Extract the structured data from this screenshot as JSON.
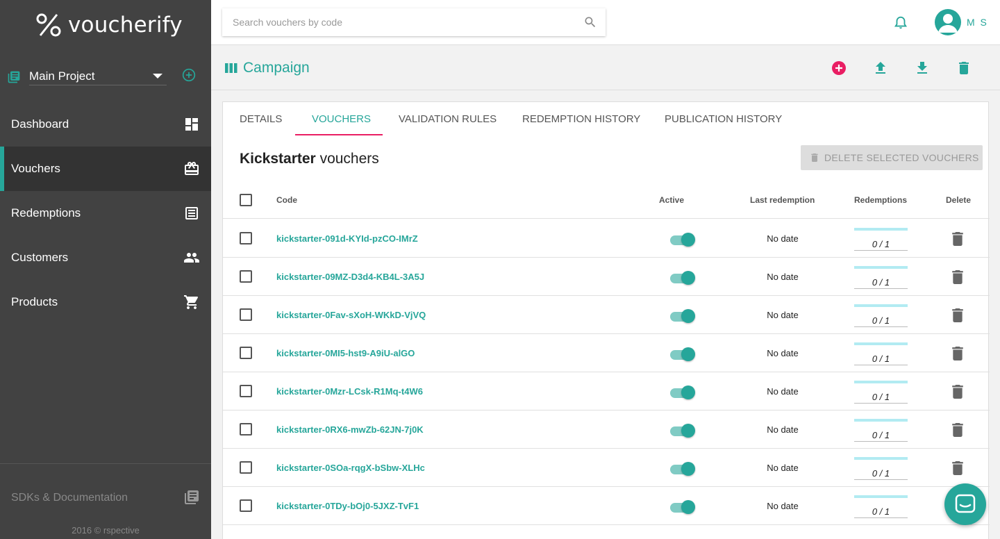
{
  "app": {
    "logo_text": "voucherify"
  },
  "sidebar": {
    "project_name": "Main Project",
    "items": [
      {
        "label": "Dashboard",
        "icon": "dashboard-icon"
      },
      {
        "label": "Vouchers",
        "icon": "gift-card-icon",
        "active": true
      },
      {
        "label": "Redemptions",
        "icon": "receipt-icon"
      },
      {
        "label": "Customers",
        "icon": "people-icon"
      },
      {
        "label": "Products",
        "icon": "cart-icon"
      }
    ],
    "sdk_label": "SDKs & Documentation",
    "copyright": "2016 © rspective"
  },
  "topbar": {
    "search_placeholder": "Search vouchers by code",
    "user_initials": "M S"
  },
  "header": {
    "title": "Campaign",
    "actions": [
      "add-icon",
      "upload-icon",
      "download-icon",
      "trash-icon"
    ]
  },
  "tabs": [
    {
      "label": "DETAILS"
    },
    {
      "label": "VOUCHERS",
      "active": true
    },
    {
      "label": "VALIDATION RULES"
    },
    {
      "label": "REDEMPTION HISTORY"
    },
    {
      "label": "PUBLICATION HISTORY"
    }
  ],
  "vouchers": {
    "title_bold": "Kickstarter",
    "title_rest": " vouchers",
    "delete_selected_label": "DELETE SELECTED VOUCHERS",
    "columns": {
      "code": "Code",
      "active": "Active",
      "last_redemption": "Last redemption",
      "redemptions": "Redemptions",
      "delete": "Delete"
    },
    "rows": [
      {
        "code": "kickstarter-091d-KYId-pzCO-IMrZ",
        "active": true,
        "last_redemption": "No date",
        "redemptions": "0 / 1"
      },
      {
        "code": "kickstarter-09MZ-D3d4-KB4L-3A5J",
        "active": true,
        "last_redemption": "No date",
        "redemptions": "0 / 1"
      },
      {
        "code": "kickstarter-0Fav-sXoH-WKkD-VjVQ",
        "active": true,
        "last_redemption": "No date",
        "redemptions": "0 / 1"
      },
      {
        "code": "kickstarter-0MI5-hst9-A9iU-alGO",
        "active": true,
        "last_redemption": "No date",
        "redemptions": "0 / 1"
      },
      {
        "code": "kickstarter-0Mzr-LCsk-R1Mq-t4W6",
        "active": true,
        "last_redemption": "No date",
        "redemptions": "0 / 1"
      },
      {
        "code": "kickstarter-0RX6-mwZb-62JN-7j0K",
        "active": true,
        "last_redemption": "No date",
        "redemptions": "0 / 1"
      },
      {
        "code": "kickstarter-0SOa-rqgX-bSbw-XLHc",
        "active": true,
        "last_redemption": "No date",
        "redemptions": "0 / 1"
      },
      {
        "code": "kickstarter-0TDy-bOj0-5JXZ-TvF1",
        "active": true,
        "last_redemption": "No date",
        "redemptions": "0 / 1"
      }
    ]
  },
  "colors": {
    "accent": "#26a69a",
    "sidebar": "#424242",
    "pink": "#e91e63"
  }
}
